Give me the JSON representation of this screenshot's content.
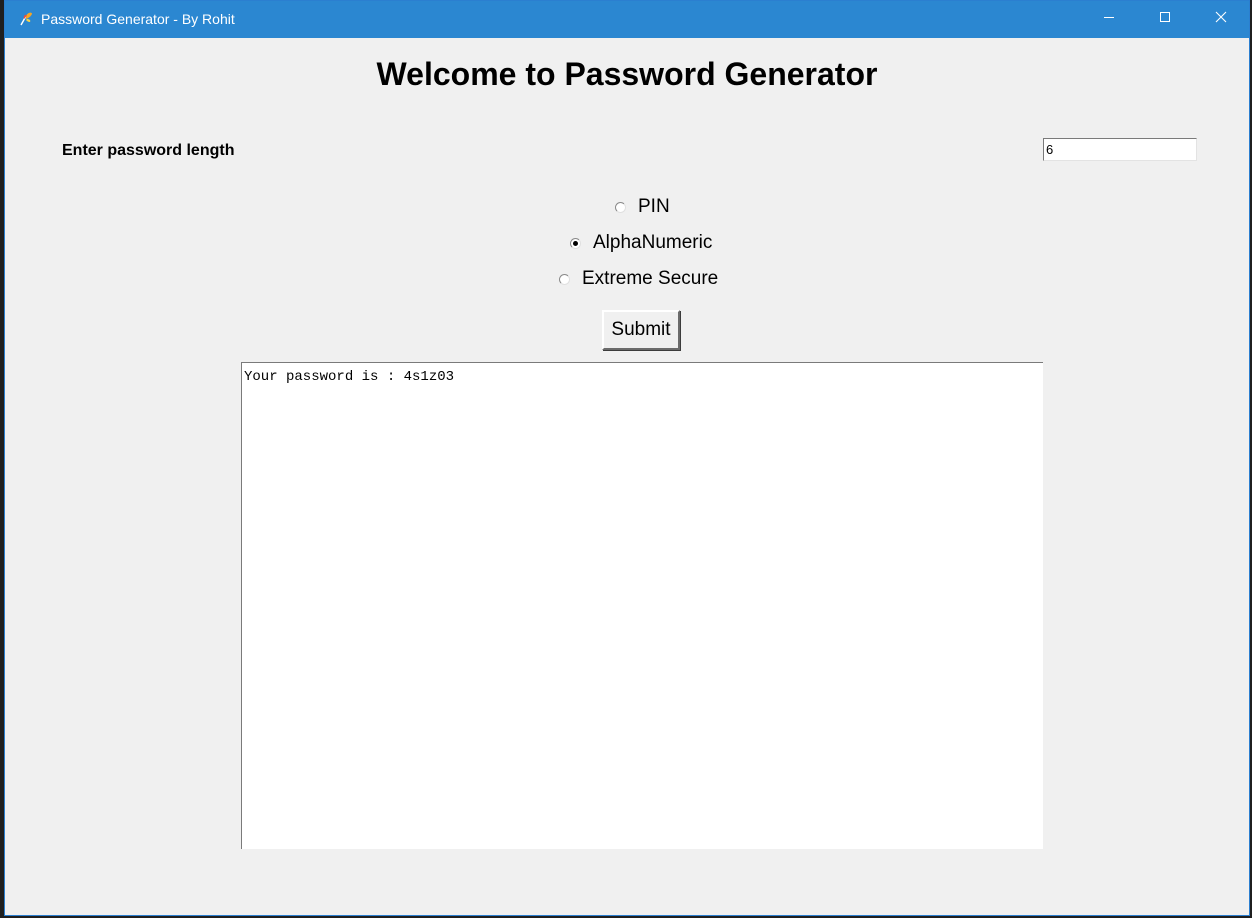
{
  "window": {
    "title": "Password Generator - By Rohit",
    "app_icon": "feather-app-icon",
    "controls": {
      "minimize_icon": "minimize-icon",
      "maximize_icon": "maximize-icon",
      "close_icon": "close-icon"
    },
    "titlebar_color": "#2b87d1"
  },
  "main": {
    "heading": "Welcome to Password Generator",
    "length_label": "Enter password length",
    "length_value": "6",
    "options": [
      {
        "label": "PIN",
        "selected": false
      },
      {
        "label": "AlphaNumeric",
        "selected": true
      },
      {
        "label": "Extreme Secure",
        "selected": false
      }
    ],
    "submit_label": "Submit",
    "output_text": "Your password is : 4s1z03"
  }
}
